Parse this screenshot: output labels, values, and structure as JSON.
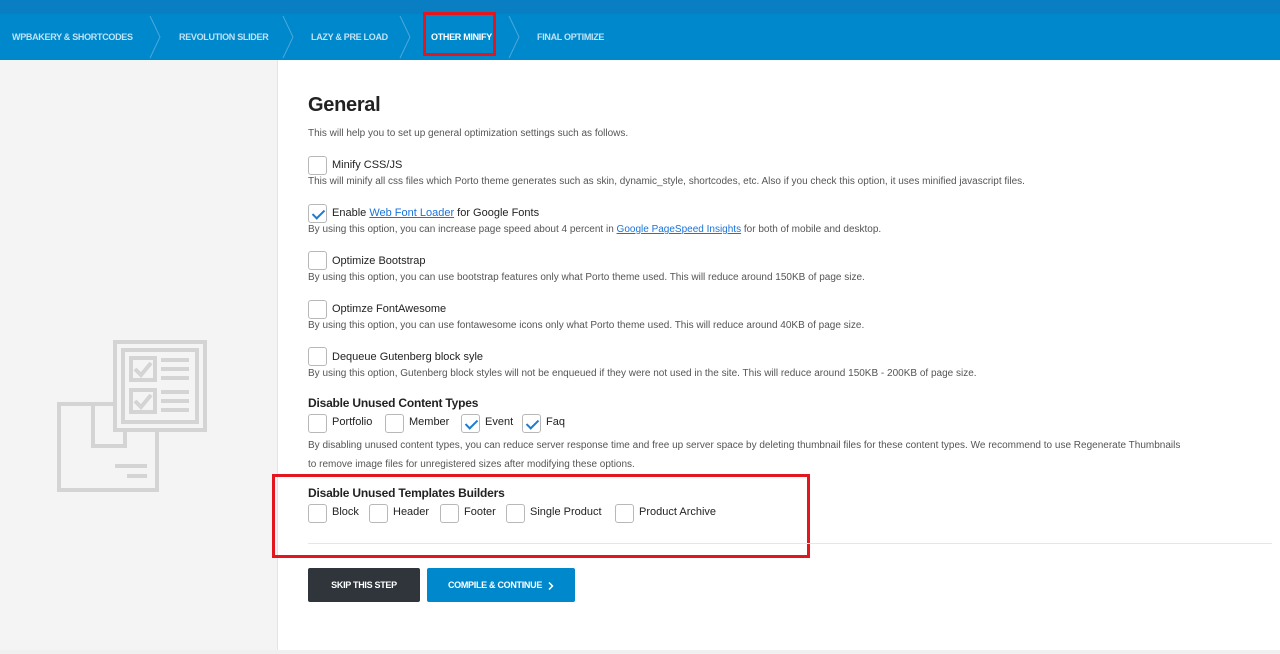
{
  "nav": {
    "steps": [
      {
        "label": "WPBAKERY & SHORTCODES"
      },
      {
        "label": "REVOLUTION SLIDER"
      },
      {
        "label": "LAZY & PRE LOAD"
      },
      {
        "label": "OTHER MINIFY"
      },
      {
        "label": "FINAL OPTIMIZE"
      }
    ],
    "active_index": 3
  },
  "main": {
    "title": "General",
    "intro": "This will help you to set up general optimization settings such as follows.",
    "options": [
      {
        "label": "Minify CSS/JS",
        "checked": false,
        "desc": "This will minify all css files which Porto theme generates such as skin, dynamic_style, shortcodes, etc. Also if you check this option, it uses minified javascript files."
      },
      {
        "label_pre": "Enable ",
        "label_link": "Web Font Loader",
        "label_post": " for Google Fonts",
        "checked": true,
        "desc_pre": "By using this option, you can increase page speed about 4 percent in ",
        "desc_link": "Google PageSpeed Insights",
        "desc_post": " for both of mobile and desktop."
      },
      {
        "label": "Optimize Bootstrap",
        "checked": false,
        "desc": "By using this option, you can use bootstrap features only what Porto theme used. This will reduce around 150KB of page size."
      },
      {
        "label": "Optimze FontAwesome",
        "checked": false,
        "desc": "By using this option, you can use fontawesome icons only what Porto theme used. This will reduce around 40KB of page size."
      },
      {
        "label": "Dequeue Gutenberg block syle",
        "checked": false,
        "desc": "By using this option, Gutenberg block styles will not be enqueued if they were not used in the site. This will reduce around 150KB - 200KB of page size."
      }
    ],
    "content_types": {
      "title": "Disable Unused Content Types",
      "items": [
        {
          "label": "Portfolio",
          "checked": false
        },
        {
          "label": "Member",
          "checked": false
        },
        {
          "label": "Event",
          "checked": true
        },
        {
          "label": "Faq",
          "checked": true
        }
      ],
      "desc_line1": "By disabling unused content types, you can reduce server response time and free up server space by deleting thumbnail files for these content types. We recommend to use Regenerate Thumbnails",
      "desc_line2": "to remove image files for unregistered sizes after modifying these options."
    },
    "templates": {
      "title": "Disable Unused Templates Builders",
      "items": [
        {
          "label": "Block",
          "checked": false
        },
        {
          "label": "Header",
          "checked": false
        },
        {
          "label": "Footer",
          "checked": false
        },
        {
          "label": "Single Product",
          "checked": false
        },
        {
          "label": "Product Archive",
          "checked": false
        }
      ]
    }
  },
  "buttons": {
    "skip": "SKIP THIS STEP",
    "continue": "COMPILE & CONTINUE"
  },
  "icons": {
    "continue_chevron": "chevron-right-icon",
    "illustration": "checklist-box-icon"
  },
  "colors": {
    "nav_bg": "#0088cc",
    "highlight": "#e3161e",
    "dark_button": "#2f353b",
    "link": "#1a73d9"
  }
}
